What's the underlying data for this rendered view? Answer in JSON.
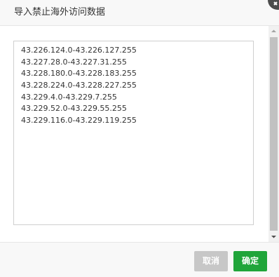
{
  "dialog": {
    "title": "导入禁止海外访问数据",
    "ip_ranges": [
      "43.226.124.0-43.226.127.255",
      "43.227.28.0-43.227.31.255",
      "43.228.180.0-43.228.183.255",
      "43.228.224.0-43.228.227.255",
      "43.229.4.0-43.229.7.255",
      "43.229.52.0-43.229.55.255",
      "43.229.116.0-43.229.119.255"
    ],
    "cancel_label": "取消",
    "confirm_label": "确定"
  },
  "icons": {
    "close": "close-icon",
    "scroll_up": "chevron-up-icon",
    "scroll_down": "chevron-down-icon"
  },
  "colors": {
    "confirm": "#20a53a",
    "cancel": "#c7c7c7",
    "close_button": "#4c4c4c"
  }
}
